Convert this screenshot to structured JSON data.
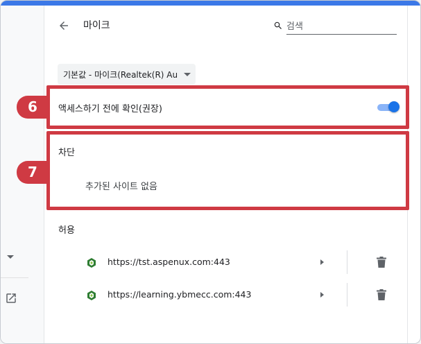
{
  "header": {
    "title": "마이크",
    "search_placeholder": "검색"
  },
  "mic_select": {
    "selected": "기본값 - 마이크(Realtek(R) Au"
  },
  "ask_setting": {
    "label": "액세스하기 전에 확인(권장)",
    "enabled": true
  },
  "markers": {
    "ask": "6",
    "block": "7"
  },
  "block_section": {
    "title": "차단",
    "empty_text": "추가된 사이트 없음"
  },
  "allow_section": {
    "title": "허용",
    "sites": [
      {
        "url": "https://tst.aspenux.com:443"
      },
      {
        "url": "https://learning.ybmecc.com:443"
      }
    ]
  },
  "colors": {
    "accent": "#1a73e8",
    "highlight": "#cf3a43",
    "topbar": "#3b78e7"
  },
  "icons": [
    "back-arrow-icon",
    "search-icon",
    "dropdown-caret-icon",
    "site-favicon-icon",
    "chevron-right-icon",
    "trash-icon",
    "external-link-icon"
  ]
}
